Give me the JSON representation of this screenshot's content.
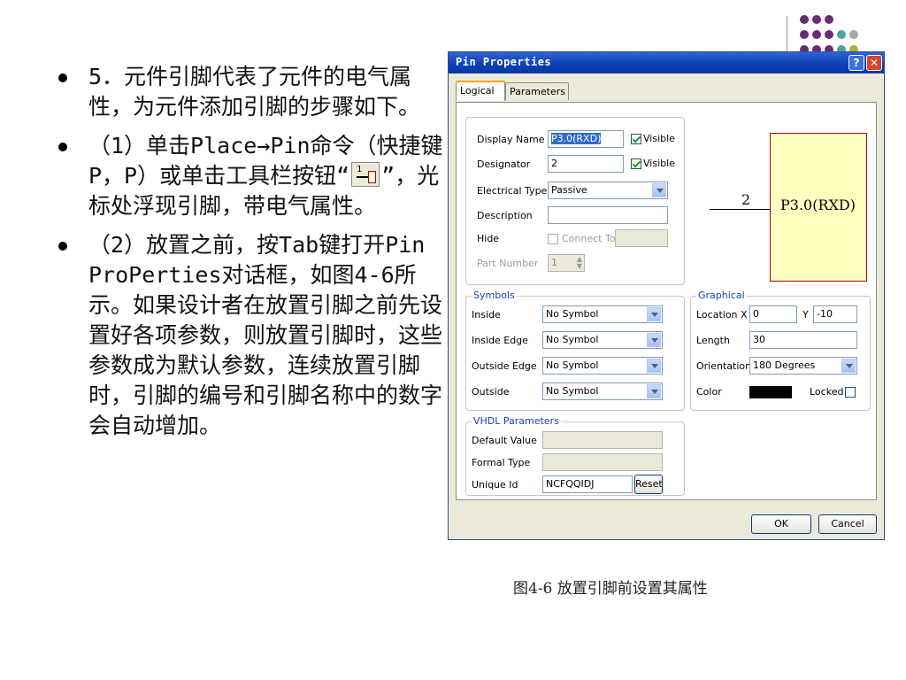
{
  "slide": {
    "bullets": [
      "5．元件引脚代表了元件的电气属性，为元件添加引脚的步骤如下。",
      "（1）单击Place→Pin命令（快捷键P，P）或单击工具栏按钮“",
      "”，光标处浮现引脚，带电气属性。",
      "（2）放置之前，按Tab键打开Pin ProPerties对话框，如图4-6所示。如果设计者在放置引脚之前先设置好各项参数，则放置引脚时，这些参数成为默认参数，连续放置引脚时，引脚的编号和引脚名称中的数字会自动增加。"
    ],
    "caption": "图4-6 放置引脚前设置其属性"
  },
  "dialog": {
    "title": "Pin Properties",
    "help": "?",
    "close": "✕",
    "tabs": [
      "Logical",
      "Parameters"
    ],
    "logical": {
      "display_name_label": "Display Name",
      "display_name_value": "P3.0(RXD)",
      "visible_label": "Visible",
      "designator_label": "Designator",
      "designator_value": "2",
      "electrical_type_label": "Electrical Type",
      "electrical_type_value": "Passive",
      "description_label": "Description",
      "hide_label": "Hide",
      "connect_to_label": "Connect To",
      "part_number_label": "Part Number",
      "part_number_value": "1"
    },
    "symbols": {
      "group_label": "Symbols",
      "inside_label": "Inside",
      "inside_value": "No Symbol",
      "inside_edge_label": "Inside Edge",
      "inside_edge_value": "No Symbol",
      "outside_edge_label": "Outside Edge",
      "outside_edge_value": "No Symbol",
      "outside_label": "Outside",
      "outside_value": "No Symbol"
    },
    "graphical": {
      "group_label": "Graphical",
      "location_label": "Location",
      "x_label": "X",
      "x_value": "0",
      "y_label": "Y",
      "y_value": "-10",
      "length_label": "Length",
      "length_value": "30",
      "orientation_label": "Orientation",
      "orientation_value": "180 Degrees",
      "color_label": "Color",
      "color_value": "#000000",
      "locked_label": "Locked"
    },
    "vhdl": {
      "group_label": "VHDL Parameters",
      "default_value_label": "Default Value",
      "formal_type_label": "Formal Type",
      "unique_id_label": "Unique Id",
      "unique_id_value": "NCFQQIDJ",
      "reset_label": "Reset"
    },
    "preview": {
      "pin_number": "2",
      "pin_name": "P3.0(RXD)"
    },
    "ok_label": "OK",
    "cancel_label": "Cancel"
  },
  "colors": {
    "deco_purple": "#6b2a78",
    "deco_teal": "#4aa3a6",
    "deco_olive": "#a9b33a"
  }
}
